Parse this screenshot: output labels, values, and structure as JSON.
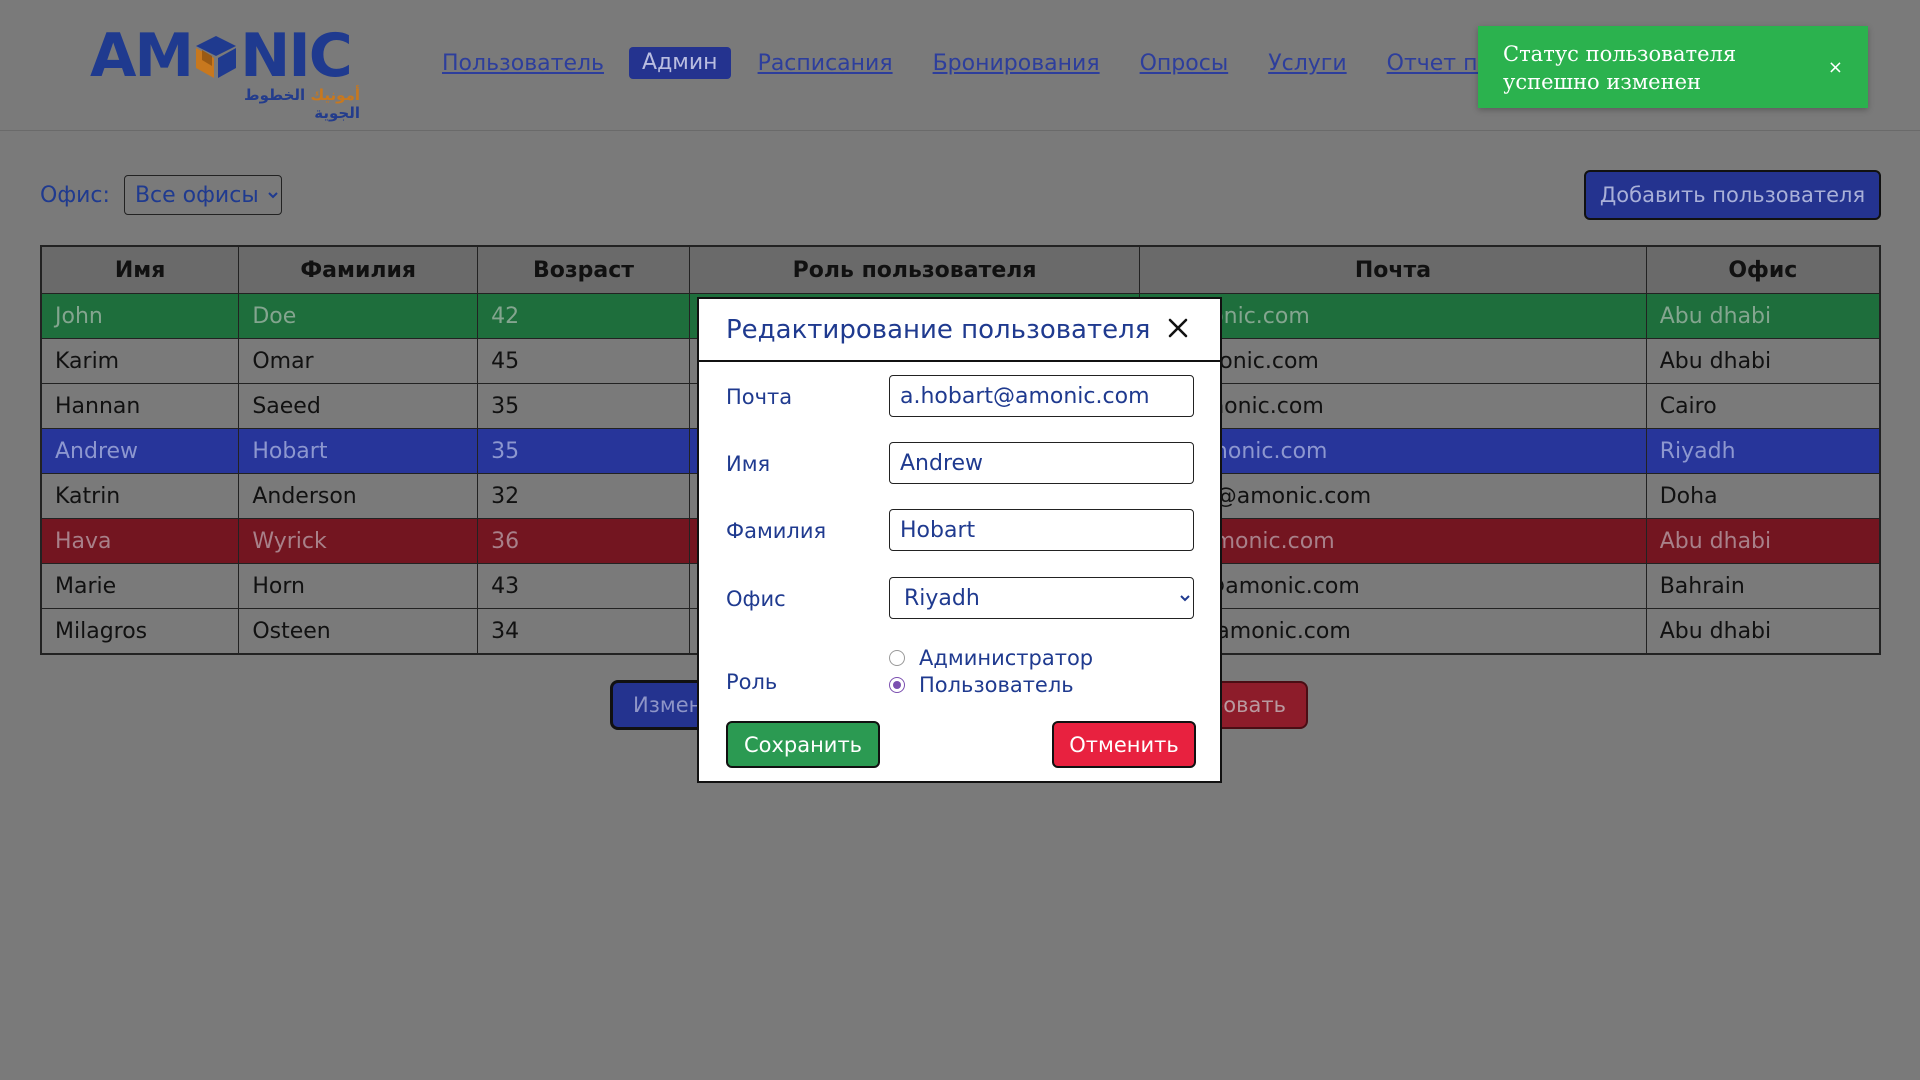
{
  "logo": {
    "wordmark_left": "AM",
    "wordmark_right": "NIC",
    "subtitle_blue": "الخطوط الجوية",
    "subtitle_orange": "أمونيك"
  },
  "nav": {
    "items": [
      "Пользователь",
      "Админ",
      "Расписания",
      "Бронирования",
      "Опросы",
      "Услуги",
      "Отчет по услу"
    ],
    "active": "Админ"
  },
  "toast": {
    "message": "Статус пользователя успешно изменен",
    "close": "×",
    "color": "#2bb24e"
  },
  "filter": {
    "label": "Офис:",
    "selected": "Все офисы"
  },
  "add_button": "Добавить пользователя",
  "table": {
    "headers": [
      "Имя",
      "Фамилия",
      "Возраст",
      "Роль пользователя",
      "Почта",
      "Офис"
    ],
    "rows": [
      {
        "first": "John",
        "last": "Doe",
        "age": "42",
        "role": "",
        "email": "@amonic.com",
        "office": "Abu dhabi",
        "state": "green"
      },
      {
        "first": "Karim",
        "last": "Omar",
        "age": "45",
        "role": "",
        "email": "r@amonic.com",
        "office": "Abu dhabi",
        "state": ""
      },
      {
        "first": "Hannan",
        "last": "Saeed",
        "age": "35",
        "role": "",
        "email": "d@amonic.com",
        "office": "Cairo",
        "state": ""
      },
      {
        "first": "Andrew",
        "last": "Hobart",
        "age": "35",
        "role": "",
        "email": "rt@amonic.com",
        "office": "Riyadh",
        "state": "blue"
      },
      {
        "first": "Katrin",
        "last": "Anderson",
        "age": "32",
        "role": "",
        "email": "erson@amonic.com",
        "office": "Doha",
        "state": ""
      },
      {
        "first": "Hava",
        "last": "Wyrick",
        "age": "36",
        "role": "",
        "email": "ck@amonic.com",
        "office": "Abu dhabi",
        "state": "red"
      },
      {
        "first": "Marie",
        "last": "Horn",
        "age": "43",
        "role": "",
        "email": "horn@amonic.com",
        "office": "Bahrain",
        "state": ""
      },
      {
        "first": "Milagros",
        "last": "Osteen",
        "age": "34",
        "role": "",
        "email": "een@amonic.com",
        "office": "Abu dhabi",
        "state": ""
      }
    ]
  },
  "bottom_buttons": {
    "edit": "Измен",
    "block": "ровать"
  },
  "modal": {
    "title": "Редактирование пользователя",
    "email_label": "Почта",
    "email_value": "a.hobart@amonic.com",
    "first_label": "Имя",
    "first_value": "Andrew",
    "last_label": "Фамилия",
    "last_value": "Hobart",
    "office_label": "Офис",
    "office_value": "Riyadh",
    "role_label": "Роль",
    "role_options": [
      "Администратор",
      "Пользователь"
    ],
    "role_selected": "Пользователь",
    "save": "Сохранить",
    "cancel": "Отменить"
  }
}
